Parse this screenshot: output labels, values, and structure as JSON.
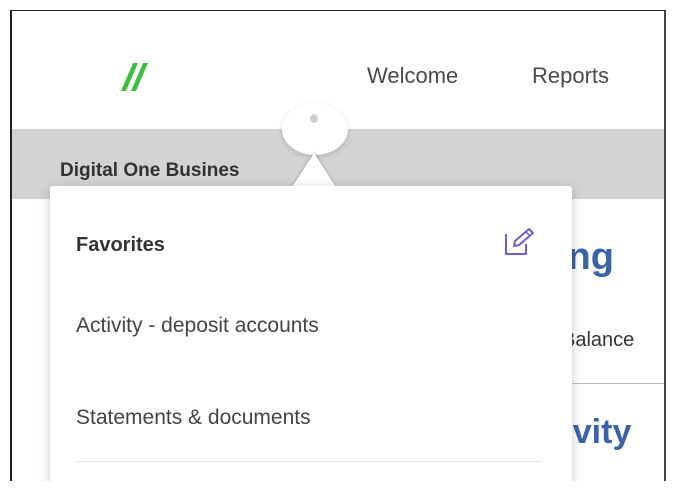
{
  "header": {
    "nav": [
      "Welcome",
      "Reports"
    ]
  },
  "account": {
    "name": "Digital One Busines"
  },
  "background": {
    "heading_1": "ing",
    "balance_label": "Balance",
    "heading_2": "tivity"
  },
  "favorites": {
    "title": "Favorites",
    "items": [
      "Activity - deposit accounts",
      "Statements & documents"
    ],
    "edit_icon": "edit-pencil-icon"
  },
  "colors": {
    "logo_green": "#3fbf3f",
    "heading_blue": "#3a63a8",
    "edit_icon_purple": "#6b5fd3",
    "band_gray": "#d3d3d3"
  }
}
